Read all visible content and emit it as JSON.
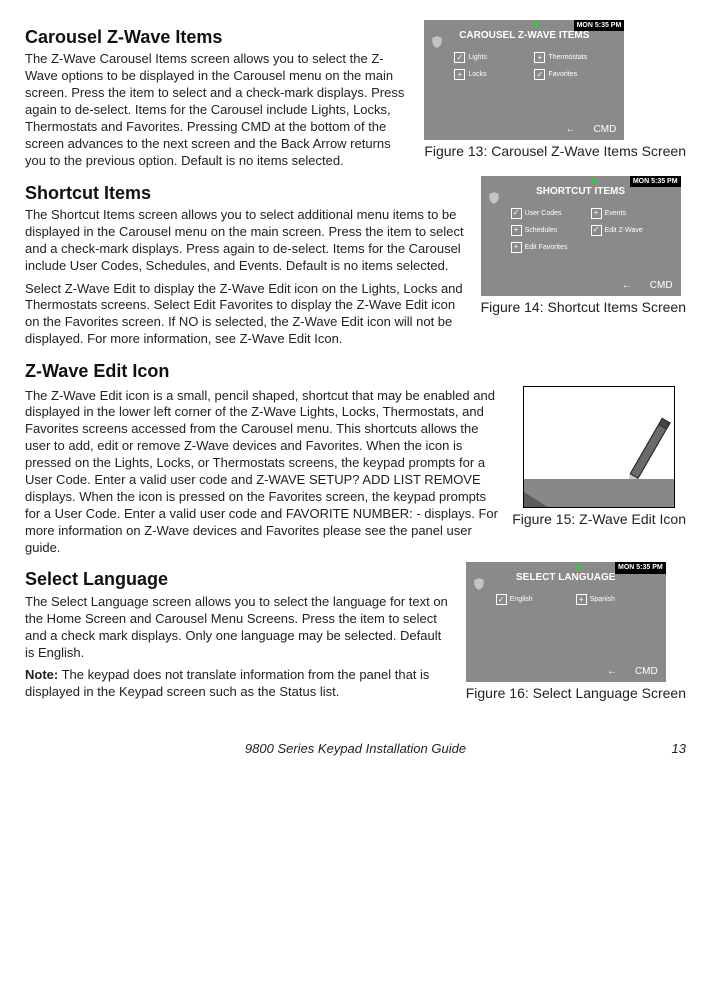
{
  "sections": {
    "carousel": {
      "heading": "Carousel Z-Wave Items",
      "body": "The Z-Wave Carousel Items screen allows you to select the Z-Wave options to be displayed in the Carousel menu on the main screen. Press the item to select and a check-mark displays. Press again to de-select. Items for the Carousel include Lights, Locks, Thermostats and Favorites. Pressing CMD at the bottom of the screen advances to the next screen and the Back Arrow returns you to the previous option. Default is no items selected."
    },
    "shortcut": {
      "heading": "Shortcut Items",
      "body1": "The Shortcut Items screen allows you to select additional menu items to be displayed in the Carousel menu on the main screen. Press the item to select and a check-mark displays. Press again to de-select. Items for the Carousel include User Codes, Schedules, and Events. Default is no items selected.",
      "body2": "Select Z-Wave Edit to display the Z-Wave Edit icon on the Lights, Locks and Thermostats screens. Select Edit Favorites to display the Z-Wave Edit icon on the Favorites screen. If NO is selected, the Z-Wave Edit icon will not be displayed. For more information, see Z-Wave Edit Icon."
    },
    "editicon": {
      "heading": "Z-Wave Edit Icon",
      "body": "The Z-Wave Edit icon is a small, pencil shaped, shortcut that may be enabled and displayed in the lower left corner of the Z-Wave Lights, Locks, Thermostats, and Favorites screens accessed from the Carousel menu. This shortcuts allows the user to add, edit or remove Z-Wave devices and Favorites. When the icon is pressed on the Lights, Locks, or Thermostats screens, the keypad prompts for a User Code. Enter a valid user code and Z-WAVE SETUP?  ADD  LIST  REMOVE displays. When the icon is pressed on the Favorites screen, the keypad prompts for a User Code. Enter a valid user code and FAVORITE NUMBER: - displays. For more information on Z-Wave devices and Favorites please see the panel user guide."
    },
    "language": {
      "heading": "Select Language",
      "body1": "The Select Language screen allows you to select the language for text on the Home Screen and Carousel Menu Screens. Press the item to select and a check mark displays. Only one language may be selected. Default is English.",
      "note_label": "Note:",
      "note_body": " The keypad does not translate information from the panel that is displayed in the Keypad screen such as the Status list."
    }
  },
  "figures": {
    "f13": {
      "title": "CAROUSEL Z-WAVE ITEMS",
      "clock": "MON 5:35 PM",
      "opts": [
        {
          "label": "Lights",
          "mark": "✓"
        },
        {
          "label": "Thermostats",
          "mark": "+"
        },
        {
          "label": "Locks",
          "mark": "+"
        },
        {
          "label": "Favorites",
          "mark": "✓"
        }
      ],
      "cmd": "CMD",
      "arrow": "←",
      "caption": "Figure 13: Carousel Z-Wave Items Screen"
    },
    "f14": {
      "title": "SHORTCUT ITEMS",
      "clock": "MON 5:35 PM",
      "opts": [
        {
          "label": "User Codes",
          "mark": "✓"
        },
        {
          "label": "Events",
          "mark": "+"
        },
        {
          "label": "Schedules",
          "mark": "+"
        },
        {
          "label": "Edit Z-Wave",
          "mark": "✓"
        },
        {
          "label": "Edit Favorites",
          "mark": "+"
        }
      ],
      "cmd": "CMD",
      "arrow": "←",
      "caption": "Figure 14: Shortcut Items Screen"
    },
    "f15": {
      "caption": "Figure 15: Z-Wave Edit Icon"
    },
    "f16": {
      "title": "SELECT LANGUAGE",
      "clock": "MON 5:35 PM",
      "opts": [
        {
          "label": "English",
          "mark": "✓"
        },
        {
          "label": "Spanish",
          "mark": "+"
        }
      ],
      "cmd": "CMD",
      "arrow": "←",
      "caption": "Figure 16: Select Language Screen"
    }
  },
  "footer": {
    "title": "9800 Series Keypad Installation Guide",
    "page": "13"
  }
}
